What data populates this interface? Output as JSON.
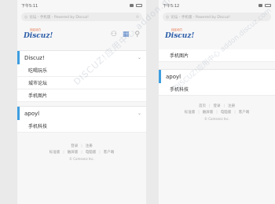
{
  "left": {
    "status": {
      "time": "下午5:11"
    },
    "url": {
      "text": "论坛 - 手机版 - Powered by Discuz!"
    },
    "logo": {
      "main": "Discuz!",
      "sub": "社区动力"
    },
    "categories": [
      {
        "title": "Discuz!",
        "forums": [
          "吃喝玩乐",
          "城市论坛",
          "手机图片"
        ]
      },
      {
        "title": "apoyl",
        "forums": [
          "手机科技"
        ]
      }
    ],
    "footer": {
      "top_links": [
        "登录",
        "注册"
      ],
      "links": [
        "标准版",
        "触屏版",
        "电脑版",
        "客户端"
      ],
      "copyright": "© Comsenz Inc."
    }
  },
  "right": {
    "status": {
      "time": "下午5:12"
    },
    "url": {
      "text": "论坛 - 手机版 - Powered by Discuz!"
    },
    "logo": {
      "main": "Discuz!",
      "sub": "社区动力"
    },
    "forum_top": "手机图片",
    "category": {
      "title": "apoyl",
      "forums": [
        "手机科技"
      ]
    },
    "footer": {
      "top_links": [
        "首页",
        "登录",
        "注册"
      ],
      "links": [
        "标准版",
        "触屏版",
        "电脑版",
        "客户端"
      ],
      "copyright": "© Comsenz Inc."
    }
  },
  "watermark": {
    "text": "DISCUZ!应用中心 addon.discuz.com"
  },
  "colors": {
    "accent": "#3d9ee0",
    "logo": "#2a5ca8"
  }
}
